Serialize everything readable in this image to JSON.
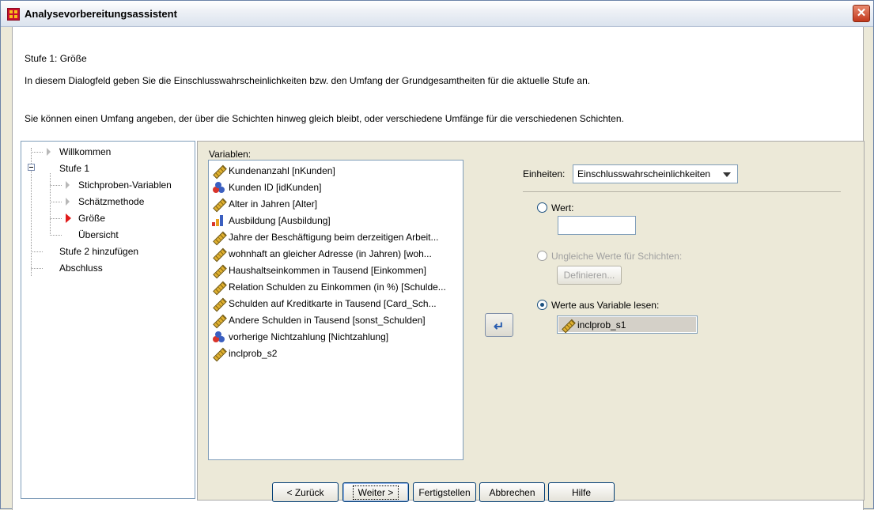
{
  "window": {
    "title": "Analysevorbereitungsassistent",
    "close_label": "✕"
  },
  "header": {
    "step_title": "Stufe 1: Größe",
    "description_1": "In diesem Dialogfeld geben Sie die Einschlusswahrscheinlichkeiten bzw. den Umfang der Grundgesamtheiten für die aktuelle Stufe an.",
    "description_2": "Sie können einen Umfang angeben, der über die Schichten hinweg gleich bleibt, oder verschiedene Umfänge für die verschiedenen Schichten."
  },
  "nav_tree": {
    "items": [
      {
        "label": "Willkommen"
      },
      {
        "label": "Stufe 1"
      },
      {
        "label": "Stichproben-Variablen"
      },
      {
        "label": "Schätzmethode"
      },
      {
        "label": "Größe"
      },
      {
        "label": "Übersicht"
      },
      {
        "label": "Stufe 2 hinzufügen"
      },
      {
        "label": "Abschluss"
      }
    ]
  },
  "variables": {
    "label": "Variablen:",
    "items": [
      {
        "label": "Kundenanzahl [nKunden]",
        "icon": "scale-ruler-icon"
      },
      {
        "label": "Kunden ID [idKunden]",
        "icon": "nominal-icon"
      },
      {
        "label": "Alter in Jahren [Alter]",
        "icon": "scale-ruler-icon"
      },
      {
        "label": "Ausbildung [Ausbildung]",
        "icon": "ordinal-bar-icon"
      },
      {
        "label": "Jahre der Beschäftigung beim derzeitigen Arbeit...",
        "icon": "scale-ruler-icon"
      },
      {
        "label": "wohnhaft an gleicher Adresse (in Jahren) [woh...",
        "icon": "scale-ruler-icon"
      },
      {
        "label": "Haushaltseinkommen in Tausend [Einkommen]",
        "icon": "scale-ruler-icon"
      },
      {
        "label": "Relation Schulden zu Einkommen (in %) [Schulde...",
        "icon": "scale-ruler-icon"
      },
      {
        "label": "Schulden auf Kreditkarte in Tausend [Card_Sch...",
        "icon": "scale-ruler-icon"
      },
      {
        "label": "Andere Schulden in Tausend [sonst_Schulden]",
        "icon": "scale-ruler-icon"
      },
      {
        "label": "vorherige Nichtzahlung [Nichtzahlung]",
        "icon": "nominal-icon"
      },
      {
        "label": "inclprob_s2",
        "icon": "scale-ruler-icon"
      }
    ]
  },
  "units": {
    "label": "Einheiten:",
    "value": "Einschlusswahrscheinlichkeiten"
  },
  "options": {
    "wert_label": "Wert:",
    "wert_value": "",
    "ungleiche_label": "Ungleiche Werte für Schichten:",
    "definieren_label": "Definieren...",
    "werte_variable_label": "Werte aus Variable lesen:",
    "selected_variable": "inclprob_s1"
  },
  "buttons": {
    "back": "< Zurück",
    "next": "Weiter >",
    "finish": "Fertigstellen",
    "cancel": "Abbrechen",
    "help": "Hilfe"
  }
}
